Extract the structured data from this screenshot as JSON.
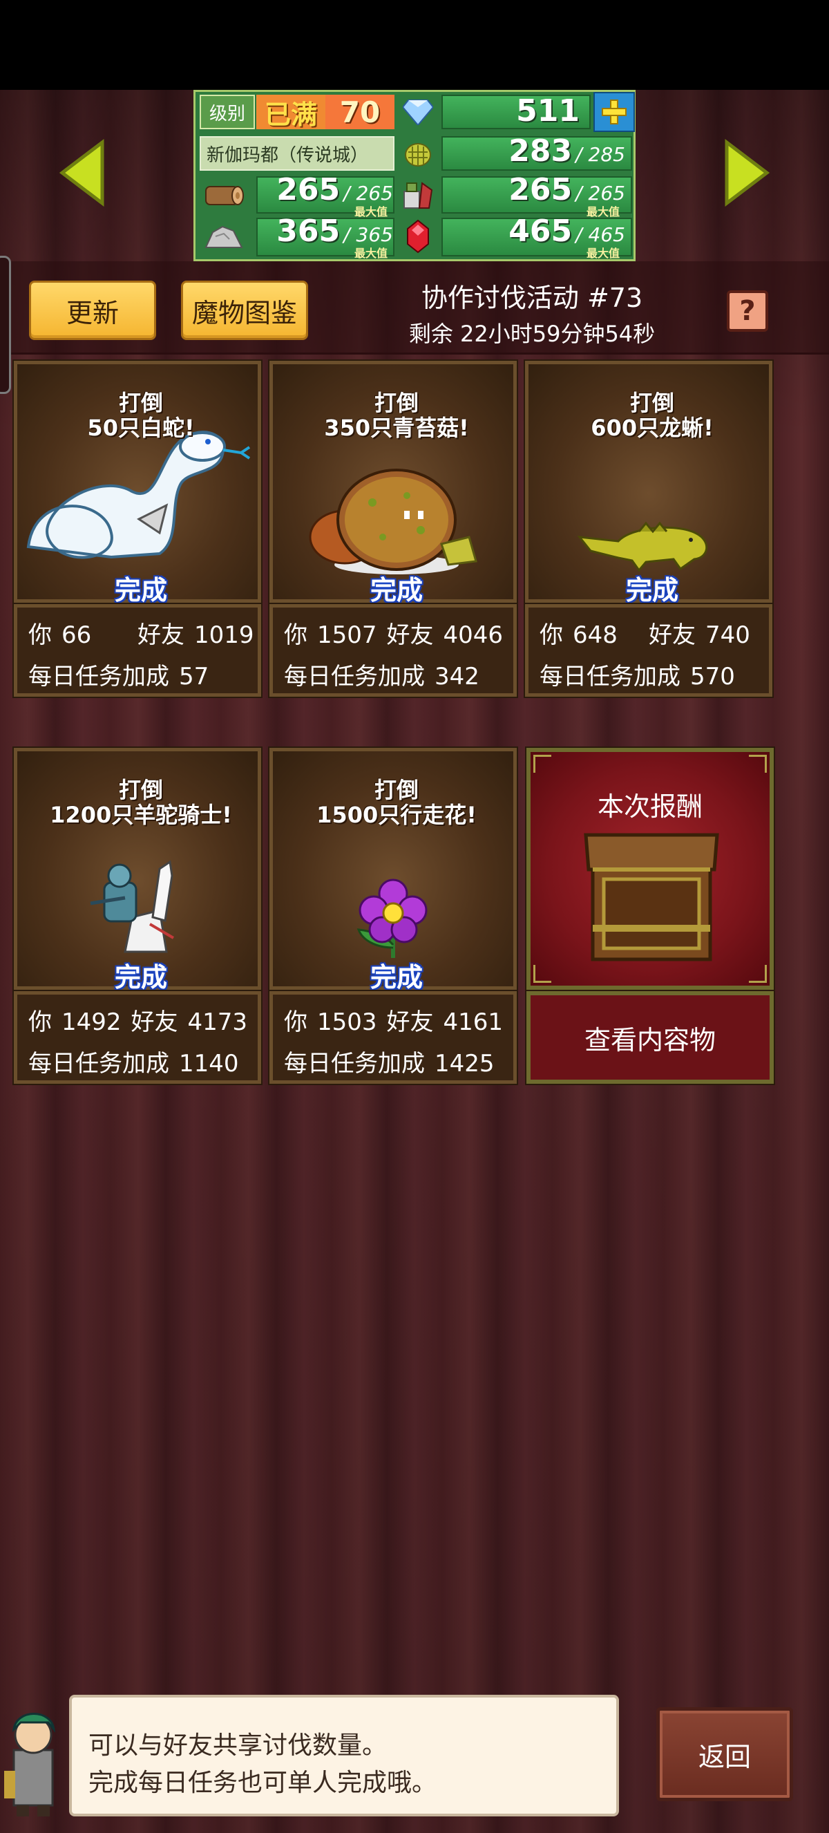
{
  "stats": {
    "level_label": "级别",
    "level_badge": "已满",
    "level_value": "70",
    "gems": "511",
    "city": "新伽玛都（传说城）",
    "grass": "283",
    "grass_max": "285",
    "wood": "265",
    "wood_max": "265",
    "food": "265",
    "food_max": "265",
    "stone": "365",
    "stone_max": "365",
    "ruby": "465",
    "ruby_max": "465",
    "max_label": "最大值"
  },
  "header": {
    "refresh_label": "更新",
    "bestiary_label": "魔物图鉴",
    "event_title": "协作讨伐活动 #73",
    "event_time": "剩余 22小时59分钟54秒",
    "help_label": "?"
  },
  "cards": [
    {
      "title1": "打倒",
      "title2": "50只白蛇!",
      "done": "完成",
      "you_label": "你",
      "you": "66",
      "friend_label": "好友",
      "friend": "1019",
      "daily_label": "每日任务加成",
      "daily": "57"
    },
    {
      "title1": "打倒",
      "title2": "350只青苔菇!",
      "done": "完成",
      "you_label": "你",
      "you": "1507",
      "friend_label": "好友",
      "friend": "4046",
      "daily_label": "每日任务加成",
      "daily": "342"
    },
    {
      "title1": "打倒",
      "title2": "600只龙蜥!",
      "done": "完成",
      "you_label": "你",
      "you": "648",
      "friend_label": "好友",
      "friend": "740",
      "daily_label": "每日任务加成",
      "daily": "570"
    },
    {
      "title1": "打倒",
      "title2": "1200只羊驼骑士!",
      "done": "完成",
      "you_label": "你",
      "you": "1492",
      "friend_label": "好友",
      "friend": "4173",
      "daily_label": "每日任务加成",
      "daily": "1140"
    },
    {
      "title1": "打倒",
      "title2": "1500只行走花!",
      "done": "完成",
      "you_label": "你",
      "you": "1503",
      "friend_label": "好友",
      "friend": "4161",
      "daily_label": "每日任务加成",
      "daily": "1425"
    }
  ],
  "reward": {
    "title": "本次报酬",
    "view_label": "查看内容物"
  },
  "dialog": {
    "line1": "可以与好友共享讨伐数量。",
    "line2": "完成每日任务也可单人完成哦。"
  },
  "back_label": "返回",
  "colors": {
    "accent_yellow": "#f5b530",
    "done_blue": "#1a3db0",
    "reward_red": "#7a141a"
  }
}
